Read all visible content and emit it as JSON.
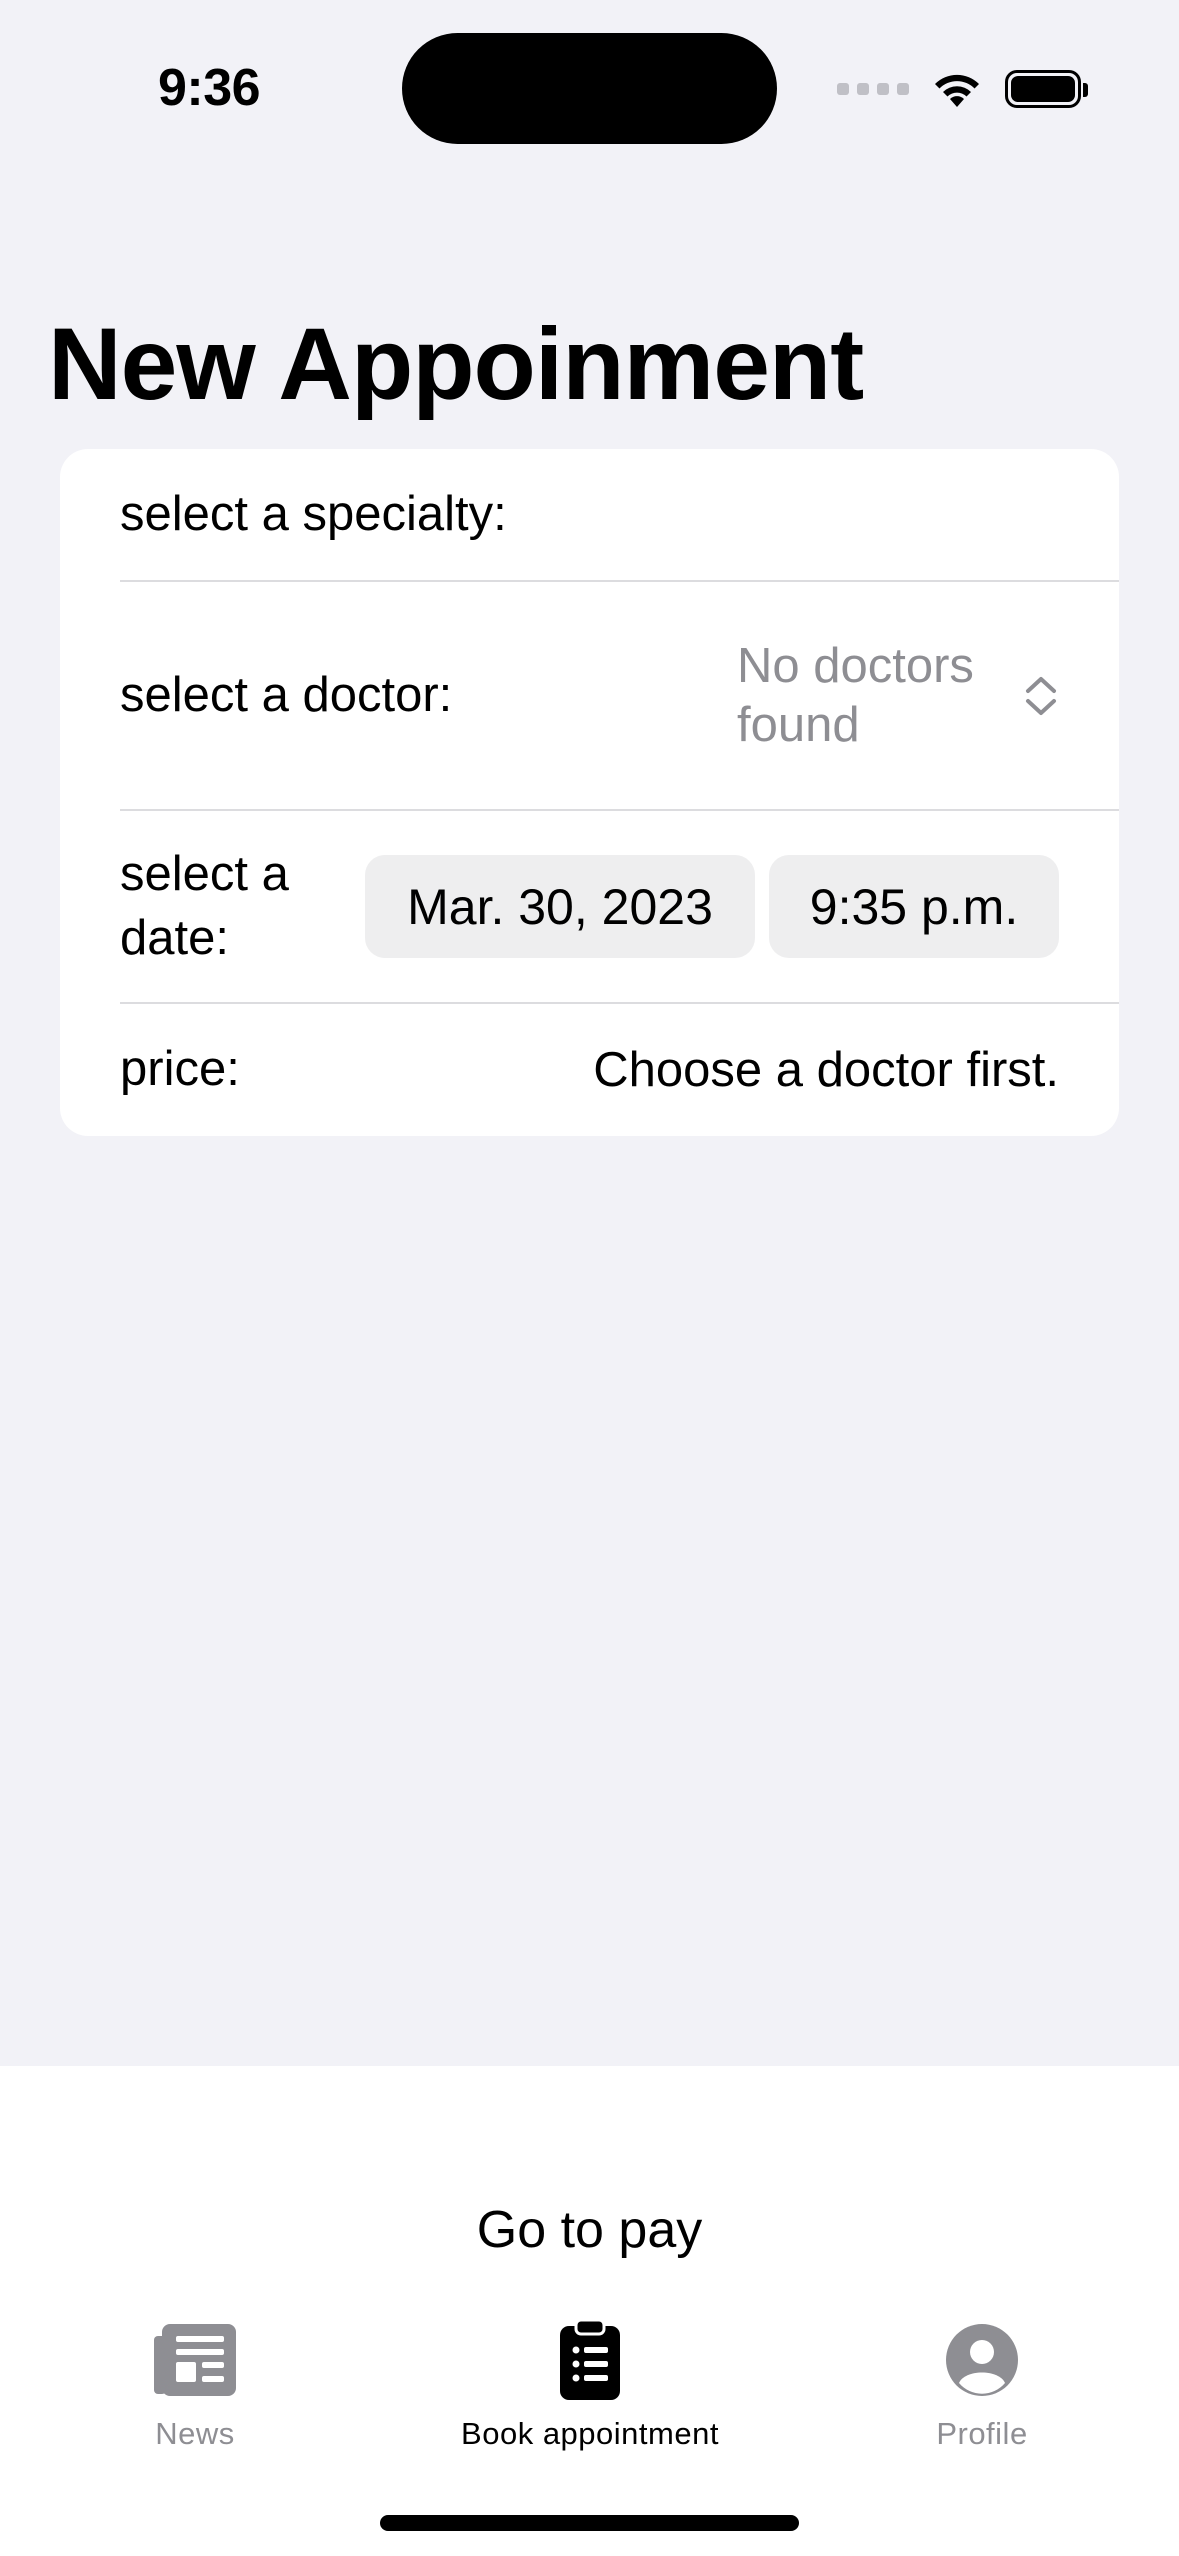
{
  "status_bar": {
    "time": "9:36"
  },
  "page": {
    "title": "New Appoinment"
  },
  "form": {
    "specialty_label": "select a specialty:",
    "doctor_label": "select a doctor:",
    "doctor_value": "No doctors found",
    "date_label": "select a date:",
    "date_value": "Mar. 30, 2023",
    "time_value": "9:35 p.m.",
    "price_label": "price:",
    "price_value": "Choose a doctor first."
  },
  "actions": {
    "pay_label": "Go to pay"
  },
  "tab_bar": {
    "tabs": [
      {
        "label": "News",
        "icon": "newspaper-icon",
        "active": false
      },
      {
        "label": "Book appointment",
        "icon": "clipboard-list-icon",
        "active": true
      },
      {
        "label": "Profile",
        "icon": "person-circle-icon",
        "active": false
      }
    ]
  },
  "colors": {
    "background": "#f2f2f7",
    "card": "#ffffff",
    "secondary_text": "#8e8e93",
    "pill_background": "#eeeeef",
    "active_tab": "#000000",
    "inactive_tab": "#8e8e93"
  }
}
